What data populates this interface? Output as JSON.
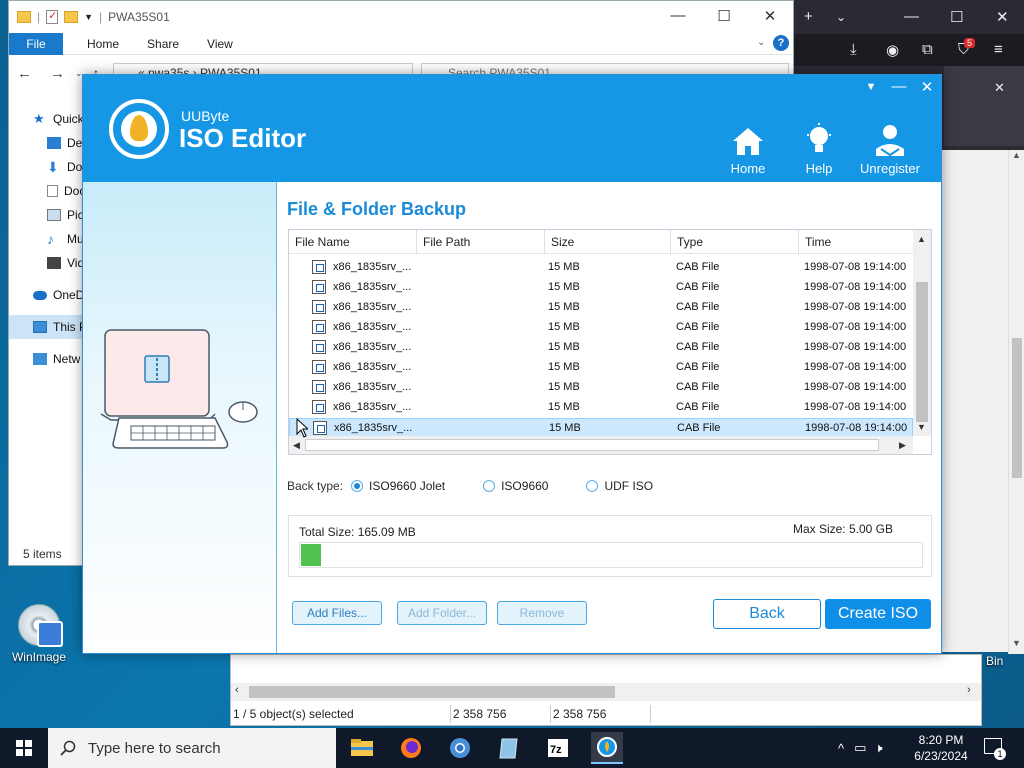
{
  "explorer": {
    "title": "PWA35S01",
    "ribbon": {
      "file": "File",
      "home": "Home",
      "share": "Share",
      "view": "View"
    },
    "address": "«  pwa35s  ›  PWA35S01",
    "search_placeholder": "Search PWA35S01",
    "nav": [
      {
        "label": "Quick",
        "icon": "star-icon"
      },
      {
        "label": "Desk",
        "icon": "desktop-icon"
      },
      {
        "label": "Dow",
        "icon": "download-icon"
      },
      {
        "label": "Doc",
        "icon": "document-icon"
      },
      {
        "label": "Pict",
        "icon": "pictures-icon"
      },
      {
        "label": "Mus",
        "icon": "music-icon"
      },
      {
        "label": "Vide",
        "icon": "video-icon"
      },
      {
        "label": "OneD",
        "icon": "onedrive-icon"
      },
      {
        "label": "This P",
        "icon": "this-pc-icon"
      },
      {
        "label": "Netw",
        "icon": "network-icon"
      }
    ],
    "status": "5 items"
  },
  "browser": {
    "badge": "5"
  },
  "desktop": {
    "winimage_label": "WinImage",
    "recycle_label": "Bin"
  },
  "winimage": {
    "status": [
      "1 / 5 object(s) selected",
      "2 358 756",
      "2 358 756"
    ]
  },
  "app": {
    "brand_sub": "UUByte",
    "brand_title": "ISO Editor",
    "nav": {
      "home": "Home",
      "help": "Help",
      "unregister": "Unregister"
    },
    "section_title": "File & Folder Backup",
    "columns": [
      "File Name",
      "File Path",
      "Size",
      "Type",
      "Time"
    ],
    "rows": [
      {
        "name": "x86_1835srv_...",
        "path": "",
        "size": "15 MB",
        "type": "CAB File",
        "time": "1998-07-08 19:14:00"
      },
      {
        "name": "x86_1835srv_...",
        "path": "",
        "size": "15 MB",
        "type": "CAB File",
        "time": "1998-07-08 19:14:00"
      },
      {
        "name": "x86_1835srv_...",
        "path": "",
        "size": "15 MB",
        "type": "CAB File",
        "time": "1998-07-08 19:14:00"
      },
      {
        "name": "x86_1835srv_...",
        "path": "",
        "size": "15 MB",
        "type": "CAB File",
        "time": "1998-07-08 19:14:00"
      },
      {
        "name": "x86_1835srv_...",
        "path": "",
        "size": "15 MB",
        "type": "CAB File",
        "time": "1998-07-08 19:14:00"
      },
      {
        "name": "x86_1835srv_...",
        "path": "",
        "size": "15 MB",
        "type": "CAB File",
        "time": "1998-07-08 19:14:00"
      },
      {
        "name": "x86_1835srv_...",
        "path": "",
        "size": "15 MB",
        "type": "CAB File",
        "time": "1998-07-08 19:14:00"
      },
      {
        "name": "x86_1835srv_...",
        "path": "",
        "size": "15 MB",
        "type": "CAB File",
        "time": "1998-07-08 19:14:00"
      },
      {
        "name": "x86_1835srv_...",
        "path": "",
        "size": "15 MB",
        "type": "CAB File",
        "time": "1998-07-08 19:14:00",
        "selected": true
      }
    ],
    "back_type_label": "Back type:",
    "back_type_options": [
      {
        "label": "ISO9660 Jolet",
        "checked": true
      },
      {
        "label": "ISO9660",
        "checked": false
      },
      {
        "label": "UDF ISO",
        "checked": false
      }
    ],
    "total_size": "Total Size: 165.09 MB",
    "max_size": "Max Size: 5.00 GB",
    "usage_fraction": 0.032,
    "buttons": {
      "add_files": "Add Files...",
      "add_folder": "Add Folder...",
      "remove": "Remove",
      "back": "Back",
      "create_iso": "Create ISO"
    },
    "colors": {
      "accent": "#1697e6",
      "progress": "#4fc24f"
    }
  },
  "taskbar": {
    "search_placeholder": "Type here to search",
    "apps": [
      "file-explorer-icon",
      "firefox-icon",
      "chrome-icon",
      "notepad-icon",
      "7zip-icon",
      "uubyte-icon"
    ],
    "clock_time": "8:20 PM",
    "clock_date": "6/23/2024",
    "notif_count": "1"
  }
}
